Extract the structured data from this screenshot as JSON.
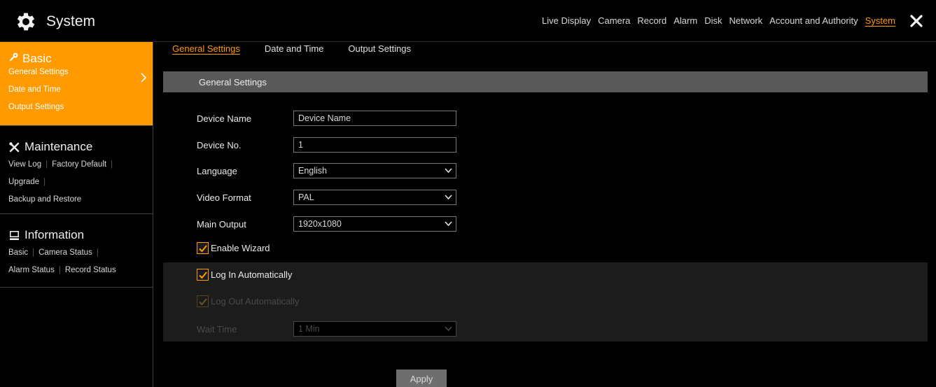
{
  "window": {
    "title": "System",
    "close_icon": "close-icon"
  },
  "topnav": {
    "items": [
      {
        "label": "Live Display",
        "active": false
      },
      {
        "label": "Camera",
        "active": false
      },
      {
        "label": "Record",
        "active": false
      },
      {
        "label": "Alarm",
        "active": false
      },
      {
        "label": "Disk",
        "active": false
      },
      {
        "label": "Network",
        "active": false
      },
      {
        "label": "Account and Authority",
        "active": false
      },
      {
        "label": "System",
        "active": true
      }
    ]
  },
  "sidebar": {
    "basic": {
      "label": "Basic",
      "icon": "wrench-key-icon",
      "items": [
        "General Settings",
        "Date and Time",
        "Output Settings"
      ]
    },
    "maintenance": {
      "label": "Maintenance",
      "icon": "tools-icon",
      "links": [
        "View Log",
        "Factory Default",
        "Upgrade",
        "Backup and Restore"
      ]
    },
    "information": {
      "label": "Information",
      "icon": "monitor-icon",
      "links": [
        "Basic",
        "Camera Status",
        "Alarm Status",
        "Record Status"
      ]
    }
  },
  "tabs": [
    {
      "label": "General Settings",
      "active": true
    },
    {
      "label": "Date and Time",
      "active": false
    },
    {
      "label": "Output Settings",
      "active": false
    }
  ],
  "section": {
    "title": "General Settings"
  },
  "form": {
    "device_name": {
      "label": "Device Name",
      "value": "Device Name"
    },
    "device_no": {
      "label": "Device No.",
      "value": "1"
    },
    "language": {
      "label": "Language",
      "value": "English"
    },
    "video_format": {
      "label": "Video Format",
      "value": "PAL"
    },
    "main_output": {
      "label": "Main Output",
      "value": "1920x1080"
    },
    "enable_wizard": {
      "label": "Enable Wizard",
      "checked": true
    },
    "log_in_auto": {
      "label": "Log In Automatically",
      "checked": true
    },
    "log_out_auto": {
      "label": "Log Out Automatically",
      "checked": true,
      "disabled": true
    },
    "wait_time": {
      "label": "Wait Time",
      "value": "1 Min",
      "disabled": true
    }
  },
  "apply_label": "Apply",
  "colors": {
    "accent": "#ff9a00",
    "header_bar": "#595959",
    "background": "#000000"
  }
}
